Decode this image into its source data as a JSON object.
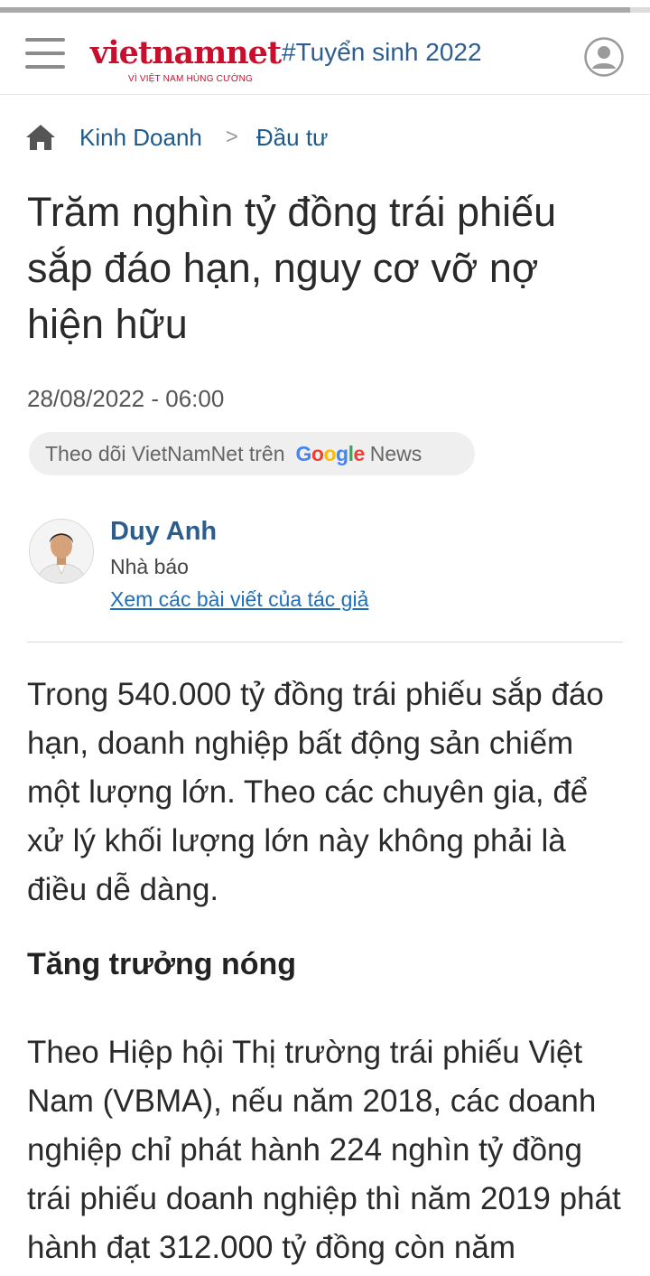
{
  "reading_progress": 0.97,
  "header": {
    "menu_icon": "hamburger-menu-icon",
    "logo": {
      "main": "vietnamnet",
      "tagline": "VÌ VIỆT NAM HÙNG CƯỜNG",
      "color": "#c8102e"
    },
    "topic": "#Tuyển sinh 2022",
    "user_icon": "user-circle-icon"
  },
  "breadcrumb": {
    "home_icon": "home-icon",
    "items": [
      "Kinh Doanh",
      "Đầu tư"
    ],
    "separator": ">"
  },
  "article": {
    "title": "Trăm nghìn tỷ đồng trái phiếu sắp đáo hạn, nguy cơ vỡ nợ hiện hữu",
    "date": "28/08/2022  - 06:00",
    "follow": {
      "text": "Theo dõi VietNamNet trên",
      "google": "Google",
      "news": "News"
    },
    "author": {
      "name": "Duy Anh",
      "role": "Nhà báo",
      "link": "Xem các bài viết của tác giả"
    },
    "sapo": "Trong 540.000 tỷ đồng trái phiếu sắp đáo hạn, doanh nghiệp bất động sản chiếm một lượng lớn. Theo các chuyên gia, để xử lý khối lượng lớn này không phải là điều dễ dàng.",
    "section_heading": "Tăng trưởng nóng",
    "paragraph": "Theo Hiệp hội Thị trường trái phiếu Việt Nam (VBMA), nếu năm 2018, các doanh nghiệp chỉ phát hành 224 nghìn tỷ đồng trái phiếu doanh nghiệp thì năm 2019 phát hành đạt 312.000 tỷ đồng còn năm"
  },
  "colors": {
    "link": "#1e5a8c",
    "author": "#2c5d8f",
    "brand": "#c8102e"
  }
}
